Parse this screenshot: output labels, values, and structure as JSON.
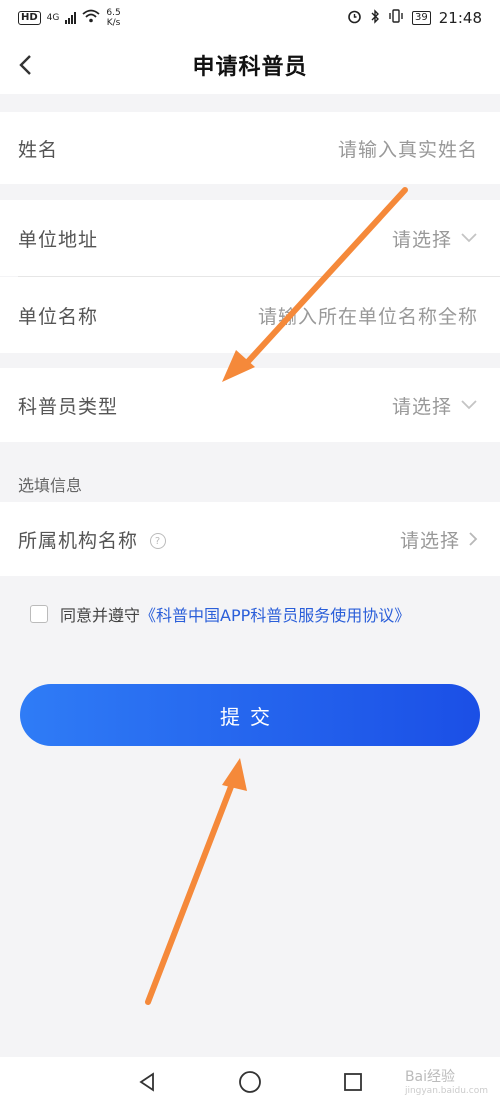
{
  "status_bar": {
    "network_badge": "HD",
    "network_type": "4G",
    "speed_value": "6.5",
    "speed_unit": "K/s",
    "battery": "39",
    "time": "21:48"
  },
  "header": {
    "title": "申请科普员"
  },
  "form": {
    "name": {
      "label": "姓名",
      "placeholder": "请输入真实姓名"
    },
    "address": {
      "label": "单位地址",
      "value": "请选择"
    },
    "org_name": {
      "label": "单位名称",
      "placeholder": "请输入所在单位名称全称"
    },
    "type": {
      "label": "科普员类型",
      "value": "请选择"
    },
    "optional_section": "选填信息",
    "institution": {
      "label": "所属机构名称",
      "help": "?",
      "value": "请选择"
    }
  },
  "agreement": {
    "prefix": "同意并遵守",
    "link": "《科普中国APP科普员服务使用协议》",
    "checked": false
  },
  "submit": {
    "label": "提交"
  },
  "annotations": {
    "arrow_color": "#f5893a"
  },
  "watermark": {
    "brand": "Bai经验",
    "url": "jingyan.baidu.com"
  },
  "colors": {
    "accent": "#2b5fd9",
    "button_start": "#2f7cf6",
    "button_end": "#1b4fe6"
  }
}
